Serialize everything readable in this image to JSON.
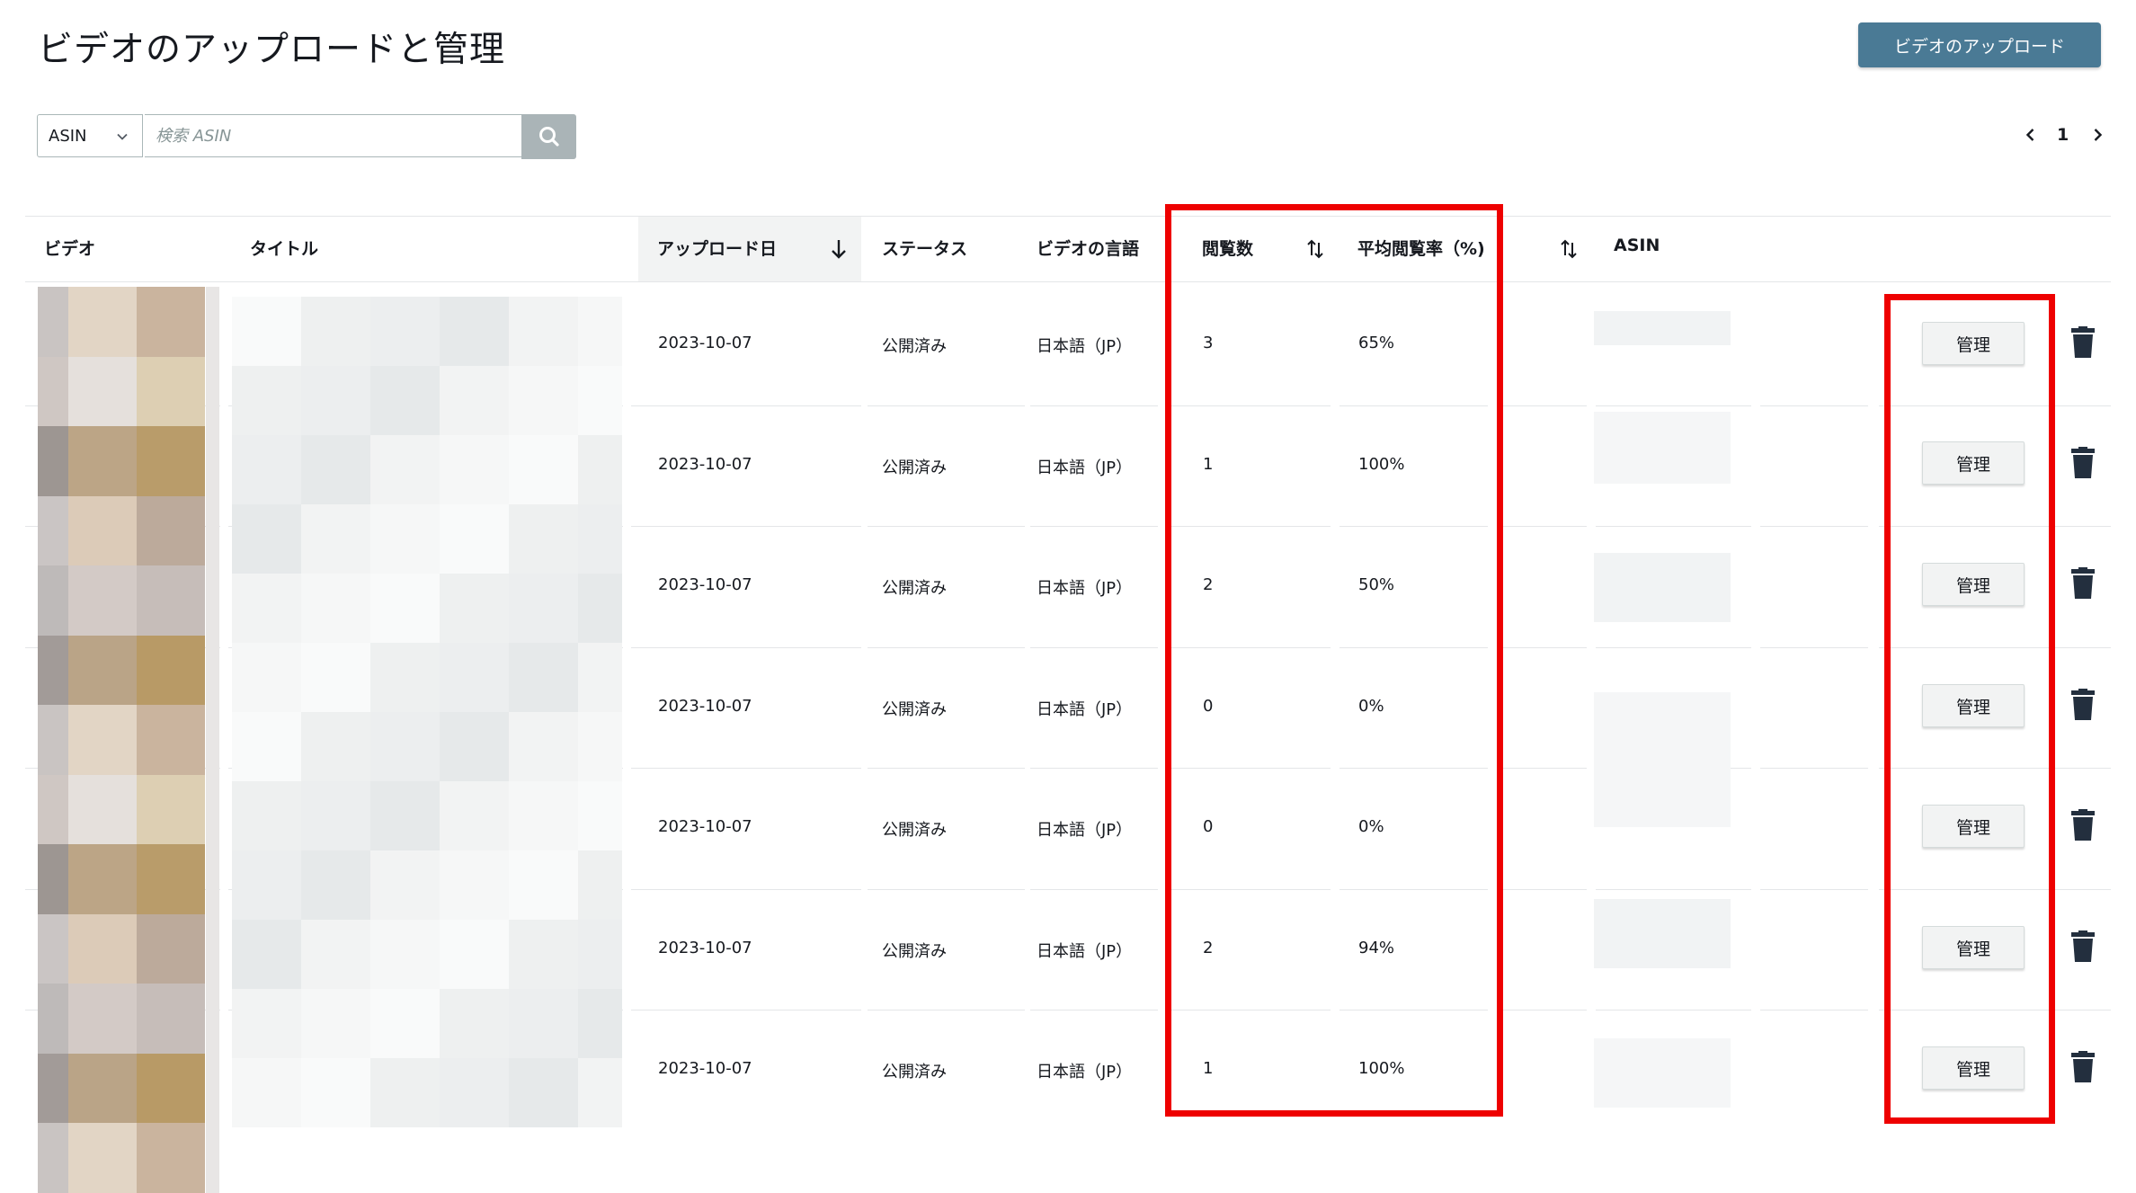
{
  "header": {
    "title": "ビデオのアップロードと管理",
    "upload_button_label": "ビデオのアップロード"
  },
  "search": {
    "select_value": "ASIN",
    "placeholder": "検索 ASIN",
    "search_icon": "search-icon"
  },
  "pagination": {
    "current_page": "1",
    "prev_icon": "chevron-left-icon",
    "next_icon": "chevron-right-icon"
  },
  "table": {
    "columns": {
      "video": "ビデオ",
      "title": "タイトル",
      "upload_date": "アップロード日",
      "status": "ステータス",
      "language": "ビデオの言語",
      "views": "閲覧数",
      "avg_view_rate": "平均閲覧率（%)",
      "asin": "ASIN"
    },
    "rows": [
      {
        "date": "2023-10-07",
        "status": "公開済み",
        "language": "日本語（JP）",
        "views": "3",
        "rate": "65%",
        "action": "管理"
      },
      {
        "date": "2023-10-07",
        "status": "公開済み",
        "language": "日本語（JP）",
        "views": "1",
        "rate": "100%",
        "action": "管理"
      },
      {
        "date": "2023-10-07",
        "status": "公開済み",
        "language": "日本語（JP）",
        "views": "2",
        "rate": "50%",
        "action": "管理"
      },
      {
        "date": "2023-10-07",
        "status": "公開済み",
        "language": "日本語（JP）",
        "views": "0",
        "rate": "0%",
        "action": "管理"
      },
      {
        "date": "2023-10-07",
        "status": "公開済み",
        "language": "日本語（JP）",
        "views": "0",
        "rate": "0%",
        "action": "管理"
      },
      {
        "date": "2023-10-07",
        "status": "公開済み",
        "language": "日本語（JP）",
        "views": "2",
        "rate": "94%",
        "action": "管理"
      },
      {
        "date": "2023-10-07",
        "status": "公開済み",
        "language": "日本語（JP）",
        "views": "1",
        "rate": "100%",
        "action": "管理"
      }
    ]
  },
  "colors": {
    "primary_button": "#4a7a95",
    "highlight_box": "#ee0000",
    "row_divider": "#e4e6e8"
  }
}
